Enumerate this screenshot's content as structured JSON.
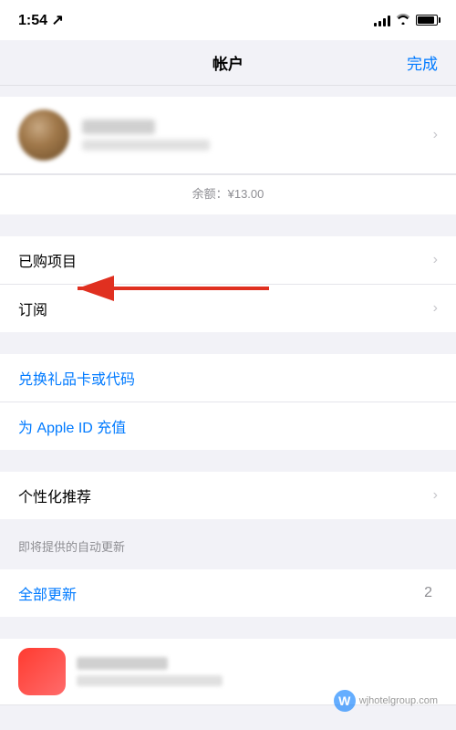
{
  "statusBar": {
    "time": "1:54",
    "arrow": "↗"
  },
  "header": {
    "title": "帐户",
    "doneLabel": "完成"
  },
  "profile": {
    "balance_label": "余额：¥13.00"
  },
  "menuItems": [
    {
      "id": "purchased",
      "label": "已购项目",
      "hasChevron": true,
      "isBlue": false
    },
    {
      "id": "subscriptions",
      "label": "订阅",
      "hasChevron": true,
      "isBlue": false
    }
  ],
  "links": [
    {
      "id": "redeem",
      "label": "兑换礼品卡或代码",
      "isBlue": true
    },
    {
      "id": "topup",
      "label": "为 Apple ID 充值",
      "isBlue": true
    }
  ],
  "section2": [
    {
      "id": "personalize",
      "label": "个性化推荐",
      "hasChevron": true,
      "isBlue": false
    }
  ],
  "upcomingSection": {
    "header": "即将提供的自动更新",
    "allUpdates": "全部更新",
    "updateCount": "2"
  },
  "watermark": {
    "text": "wjhotelgroup.com"
  }
}
